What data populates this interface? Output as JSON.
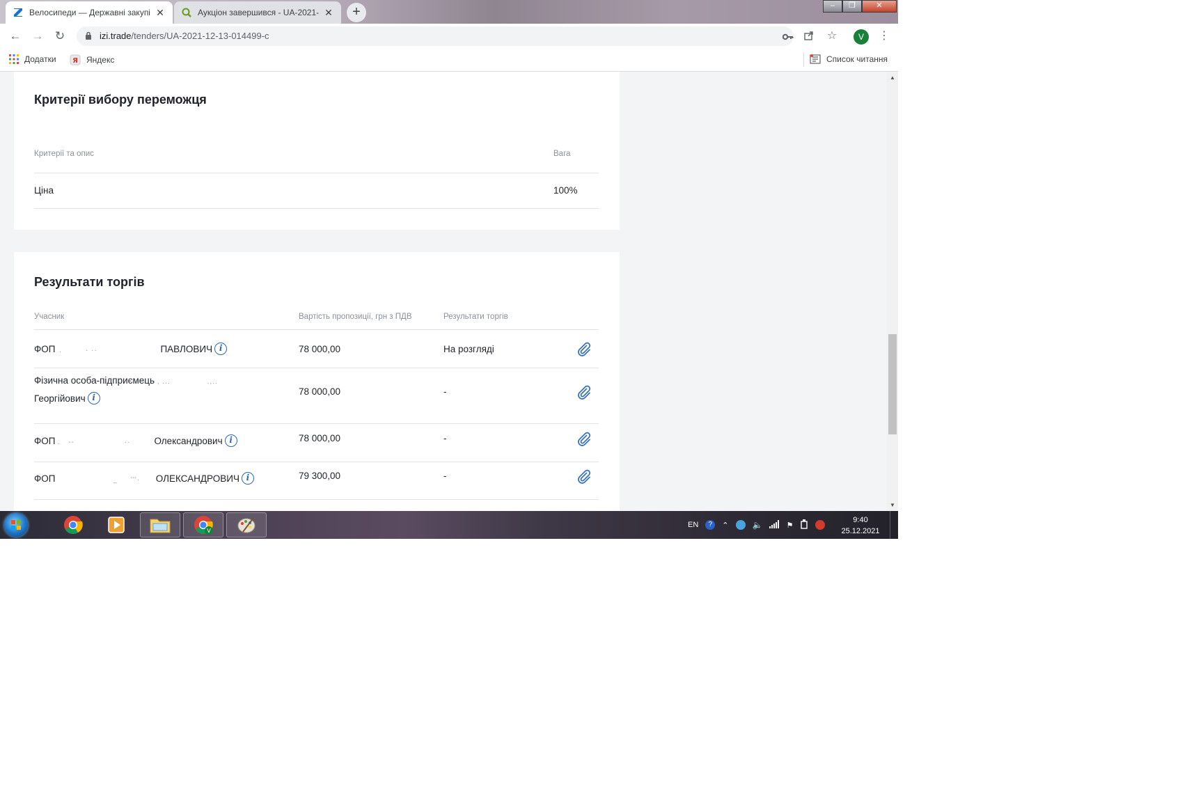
{
  "browser": {
    "tabs": [
      {
        "title": "Велосипеди — Державні закупівлі",
        "active": true,
        "icon": "izi-trade-favicon"
      },
      {
        "title": "Аукціон завершився - UA-2021-",
        "active": false,
        "icon": "prozorro-favicon"
      }
    ],
    "new_tab_label": "+",
    "url_host": "izi.trade",
    "url_path": "/tenders/UA-2021-12-13-014499-c",
    "bookmarks": [
      {
        "label": "Додатки",
        "icon": "apps-grid-icon"
      },
      {
        "label": "Яндекс",
        "icon": "yandex-icon"
      }
    ],
    "reading_list_label": "Список читання",
    "profile_initial": "V"
  },
  "criteria": {
    "title": "Критерії вибору переможця",
    "col_criteria": "Критерії та опис",
    "col_weight": "Вага",
    "rows": [
      {
        "name": "Ціна",
        "weight": "100%"
      }
    ]
  },
  "results": {
    "title": "Результати торгів",
    "col_participant": "Учасник",
    "col_price": "Вартість пропозиції, грн з ПДВ",
    "col_result": "Результати торгів",
    "rows": [
      {
        "participant_a": "ФОП",
        "participant_b": "ПАВЛОВИЧ",
        "price": "78 000,00",
        "result": "На розгляді"
      },
      {
        "participant_a": "Фізична особа-підприємець",
        "participant_b": "Георгійович",
        "price": "78 000,00",
        "result": "-"
      },
      {
        "participant_a": "ФОП",
        "participant_b": "Олександрович",
        "price": "78 000,00",
        "result": "-"
      },
      {
        "participant_a": "ФОП",
        "participant_b": "ОЛЕКСАНДРОВИЧ",
        "price": "79 300,00",
        "result": "-"
      }
    ]
  },
  "taskbar": {
    "language": "EN",
    "time": "9:40",
    "date": "25.12.2021"
  }
}
